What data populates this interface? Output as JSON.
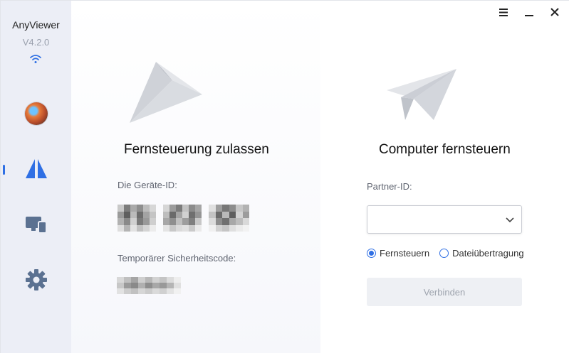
{
  "app": {
    "name": "AnyViewer",
    "version": "V4.2.0"
  },
  "window": {
    "menu_icon": "hamburger-icon",
    "minimize_icon": "minimize-icon",
    "close_icon": "close-icon"
  },
  "sidebar": {
    "items": [
      {
        "name": "avatar",
        "icon": "user-avatar"
      },
      {
        "name": "remote-control",
        "icon": "anyviewer-logo-icon",
        "active": true
      },
      {
        "name": "devices",
        "icon": "devices-icon"
      },
      {
        "name": "settings",
        "icon": "gear-icon"
      }
    ]
  },
  "left": {
    "title": "Fernsteuerung zulassen",
    "device_id_label": "Die Geräte-ID:",
    "temp_code_label": "Temporärer Sicherheitscode:"
  },
  "right": {
    "title": "Computer fernsteuern",
    "partner_id_label": "Partner-ID:",
    "partner_id_value": "",
    "options": [
      {
        "label": "Fernsteuern",
        "selected": true
      },
      {
        "label": "Dateiübertragung",
        "selected": false
      }
    ],
    "connect_label": "Verbinden"
  },
  "colors": {
    "accent": "#2f6fe4",
    "sidebar_bg": "#eceef6",
    "icon_gray": "#5b7191"
  }
}
